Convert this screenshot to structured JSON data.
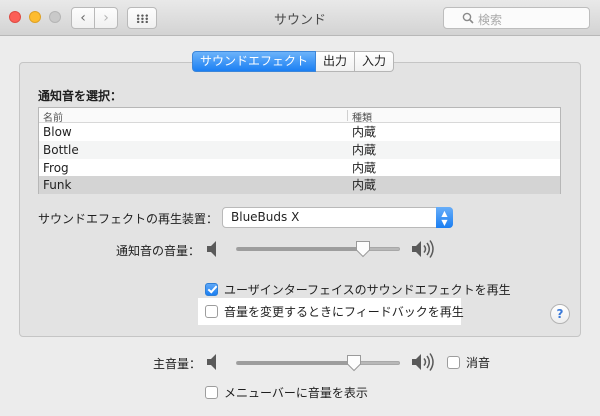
{
  "window": {
    "title": "サウンド"
  },
  "search": {
    "placeholder": "検索"
  },
  "tabs": [
    {
      "label": "サウンドエフェクト",
      "active": true
    },
    {
      "label": "出力",
      "active": false
    },
    {
      "label": "入力",
      "active": false
    }
  ],
  "alert": {
    "select_label": "通知音を選択：",
    "columns": {
      "name": "名前",
      "type": "種類"
    },
    "sounds": [
      {
        "name": "Blow",
        "type": "内蔵"
      },
      {
        "name": "Bottle",
        "type": "内蔵"
      },
      {
        "name": "Frog",
        "type": "内蔵"
      },
      {
        "name": "Funk",
        "type": "内蔵",
        "selected": true
      }
    ]
  },
  "playback_device": {
    "label": "サウンドエフェクトの再生装置：",
    "value": "BlueBuds X"
  },
  "alert_volume": {
    "label": "通知音の音量：",
    "level": 0.78
  },
  "options": {
    "ui_effects": {
      "label": "ユーザインターフェイスのサウンドエフェクトを再生",
      "checked": true
    },
    "volume_feedback": {
      "label": "音量を変更するときにフィードバックを再生",
      "checked": false
    }
  },
  "output_volume": {
    "label": "主音量：",
    "level": 0.72,
    "mute_label": "消音",
    "muted": false
  },
  "menubar": {
    "label": "メニューバーに音量を表示",
    "checked": false
  },
  "help": {
    "label": "?"
  },
  "icons": {
    "back": "‹",
    "forward": "›"
  },
  "colors": {
    "accent": "#1b7ff3"
  }
}
